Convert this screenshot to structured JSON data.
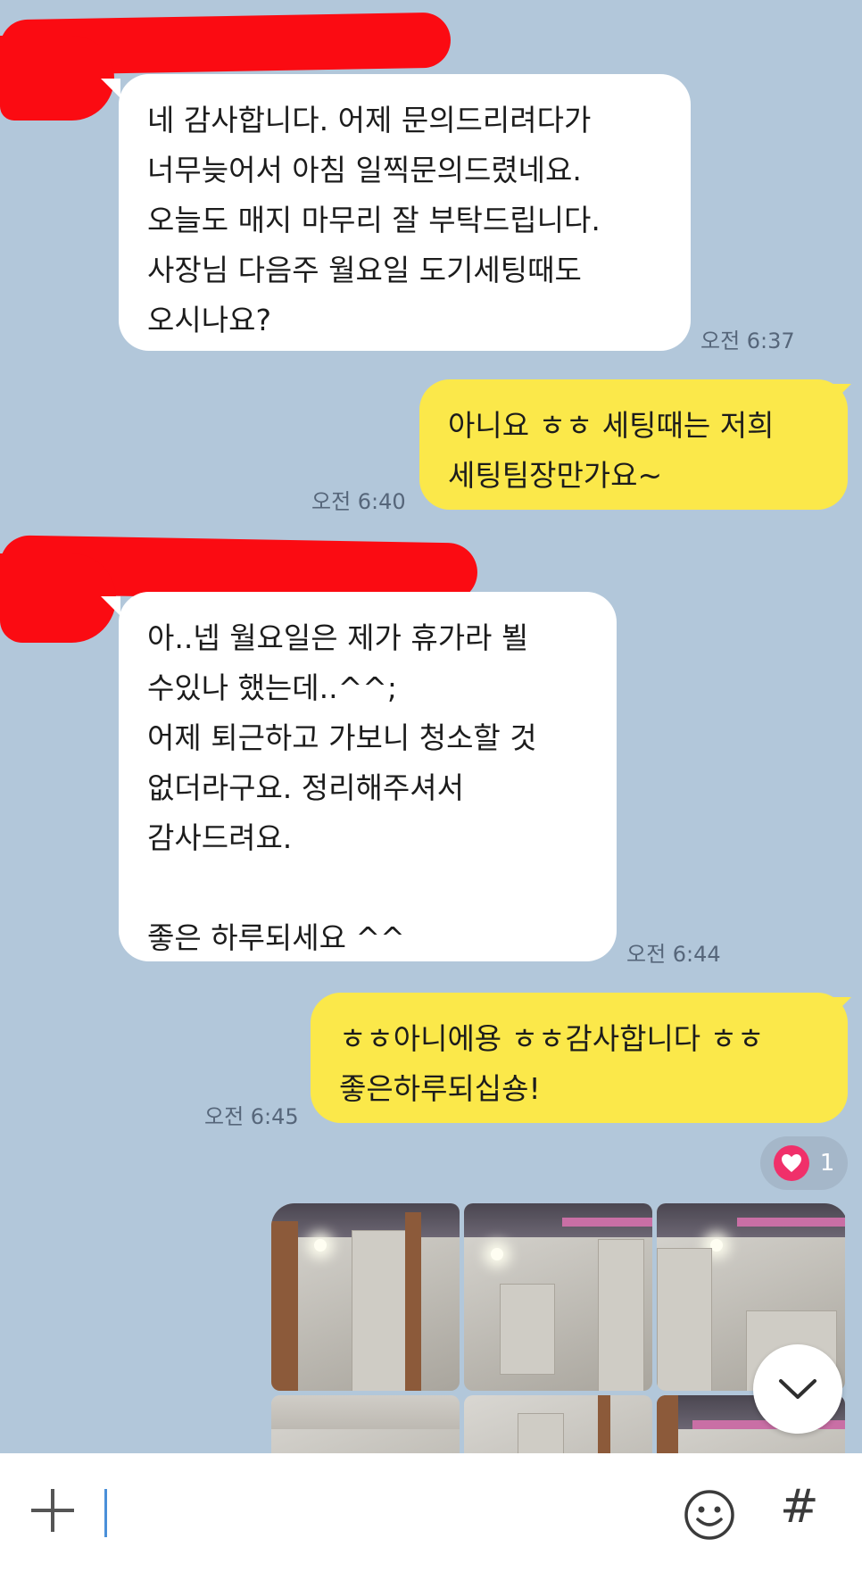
{
  "messages": [
    {
      "side": "in",
      "text": "네 감사합니다. 어제 문의드리려다가\n너무늦어서 아침 일찍문의드렸네요.\n오늘도 매지 마무리 잘 부탁드립니다.\n사장님 다음주 월요일 도기세팅때도\n오시나요?",
      "time": "오전 6:37"
    },
    {
      "side": "out",
      "text": "아니요 ㅎㅎ 세팅때는 저희\n세팅팀장만가요~",
      "time": "오전 6:40"
    },
    {
      "side": "in",
      "text": "아..넵 월요일은 제가 휴가라 뵐\n수있나 했는데..^^;\n어제 퇴근하고 가보니 청소할 것\n없더라구요. 정리해주셔서\n감사드려요.\n\n좋은 하루되세요 ^^",
      "time": "오전 6:44"
    },
    {
      "side": "out",
      "text": "ㅎㅎ아니에용 ㅎㅎ감사합니다 ㅎㅎ\n좋은하루되십숑!",
      "time": "오전 6:45"
    }
  ],
  "reaction": {
    "icon": "heart-icon",
    "count": "1",
    "color": "#f0306a"
  },
  "colors": {
    "background": "#b2c7da",
    "incoming": "#ffffff",
    "outgoing": "#fbe84a",
    "redaction": "#fb0b12"
  },
  "input_bar": {
    "plus_icon": "plus-icon",
    "emoji_icon": "emoji-icon",
    "hash_label": "#"
  }
}
